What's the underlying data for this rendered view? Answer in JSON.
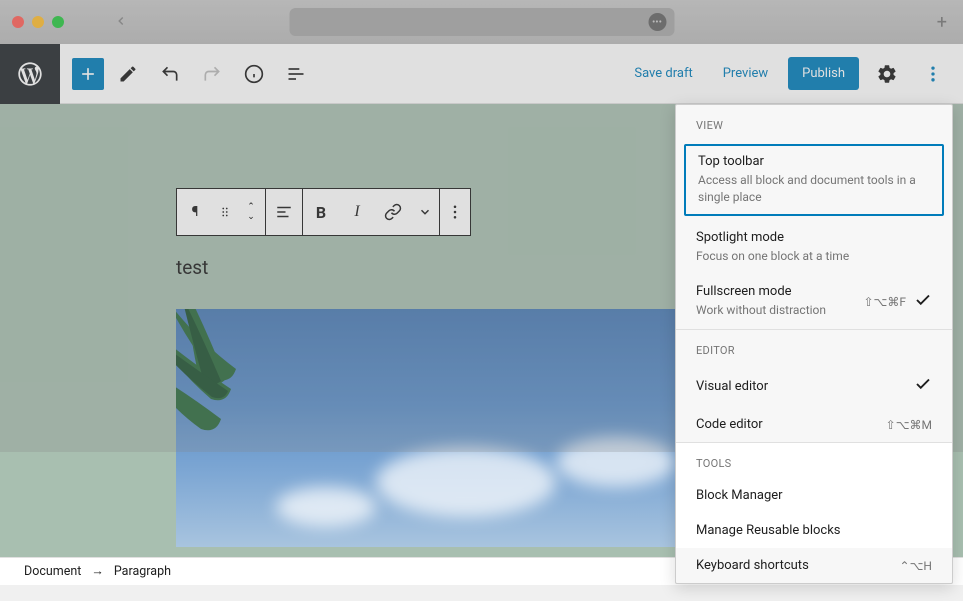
{
  "topbar": {
    "save_draft": "Save draft",
    "preview": "Preview",
    "publish": "Publish"
  },
  "block_toolbar": {
    "bold": "B",
    "italic": "I"
  },
  "content": {
    "paragraph_text": "test"
  },
  "breadcrumb": {
    "root": "Document",
    "arrow": "→",
    "current": "Paragraph"
  },
  "options_menu": {
    "sections": {
      "view": "View",
      "editor": "Editor",
      "tools": "Tools"
    },
    "top_toolbar": {
      "title": "Top toolbar",
      "desc": "Access all block and document tools in a single place"
    },
    "spotlight": {
      "title": "Spotlight mode",
      "desc": "Focus on one block at a time"
    },
    "fullscreen": {
      "title": "Fullscreen mode",
      "desc": "Work without distraction",
      "shortcut": "⇧⌥⌘F"
    },
    "visual_editor": "Visual editor",
    "code_editor": {
      "title": "Code editor",
      "shortcut": "⇧⌥⌘M"
    },
    "block_manager": "Block Manager",
    "manage_reusable": "Manage Reusable blocks",
    "keyboard_shortcuts": {
      "title": "Keyboard shortcuts",
      "shortcut": "⌃⌥H"
    }
  }
}
